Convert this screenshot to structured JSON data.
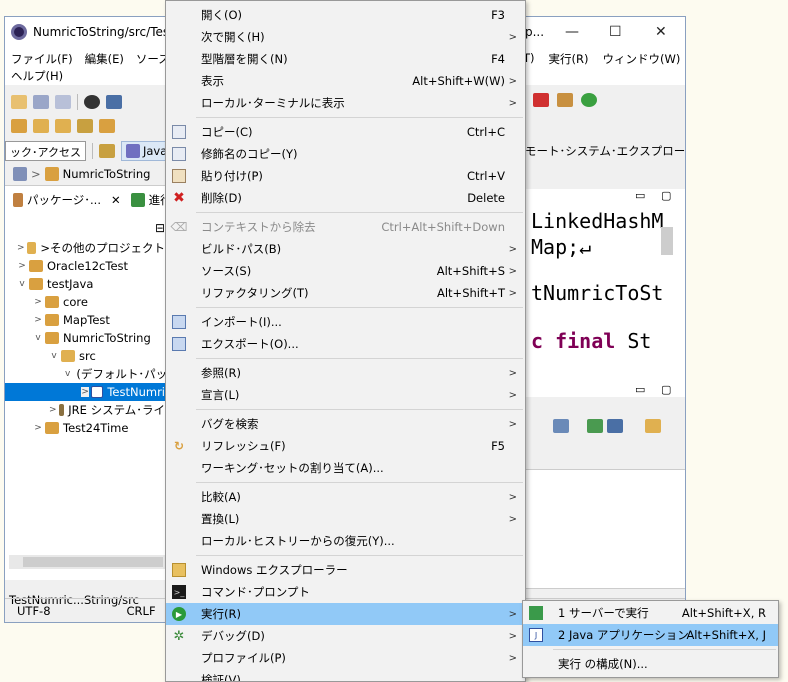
{
  "window": {
    "title": "NumricToString/src/TestN",
    "title_right": "p..."
  },
  "menubar": {
    "items": [
      "ファイル(F)",
      "編集(E)",
      "ソース(S)",
      "ヘルプ(H)"
    ],
    "right_items": [
      "T)",
      "実行(R)",
      "ウィンドウ(W)"
    ]
  },
  "toolbar3": {
    "quick_access": "ック･アクセス",
    "perspective": "Java",
    "remote": "モート･システム･エクスプローラー"
  },
  "breadcrumb": "NumricToString",
  "left_pane": {
    "tab_label": "パッケージ･...",
    "tab2_label": "進行"
  },
  "tree": [
    {
      "label": ">その他のプロジェクト",
      "indent": 0,
      "twisty": ">"
    },
    {
      "label": "Oracle12cTest",
      "indent": 0,
      "twisty": ">"
    },
    {
      "label": "testJava",
      "indent": 0,
      "twisty": "v"
    },
    {
      "label": "core",
      "indent": 1,
      "twisty": ">"
    },
    {
      "label": "MapTest",
      "indent": 1,
      "twisty": ">"
    },
    {
      "label": "NumricToString",
      "indent": 1,
      "twisty": "v"
    },
    {
      "label": "src",
      "indent": 2,
      "twisty": "v"
    },
    {
      "label": "(デフォルト･パッ",
      "indent": 3,
      "twisty": "v"
    },
    {
      "label": "TestNumri",
      "indent": 4,
      "twisty": ">"
    },
    {
      "label": "JRE システム･ライ",
      "indent": 2,
      "twisty": ">"
    },
    {
      "label": "Test24Time",
      "indent": 0,
      "twisty": ">"
    }
  ],
  "editor": {
    "line1": "LinkedHashM",
    "line2": "Map;↵",
    "line3": "tNumricToSt",
    "line4_kw": "c final",
    "line4_rest": " St"
  },
  "pathbar": "TestNumric...String/src",
  "statusbar": {
    "encoding": "UTF-8",
    "line_ending": "CRLF"
  },
  "context_menu": {
    "items": [
      {
        "label": "開く(O)",
        "shortcut": "F3"
      },
      {
        "label": "次で開く(H)",
        "submenu": true
      },
      {
        "label": "型階層を開く(N)",
        "shortcut": "F4"
      },
      {
        "label": "表示",
        "shortcut": "Alt+Shift+W(W)",
        "submenu": true
      },
      {
        "label": "ローカル･ターミナルに表示",
        "submenu": true
      },
      {
        "label": "コピー(C)",
        "shortcut": "Ctrl+C",
        "icon": "copy-icon"
      },
      {
        "label": "修飾名のコピー(Y)",
        "icon": "copy-qualified-icon"
      },
      {
        "label": "貼り付け(P)",
        "shortcut": "Ctrl+V",
        "icon": "paste-icon"
      },
      {
        "label": "削除(D)",
        "shortcut": "Delete",
        "icon": "delete-icon"
      },
      {
        "label": "コンテキストから除去",
        "shortcut": "Ctrl+Alt+Shift+Down",
        "disabled": true
      },
      {
        "label": "ビルド･パス(B)",
        "submenu": true
      },
      {
        "label": "ソース(S)",
        "shortcut": "Alt+Shift+S",
        "submenu": true
      },
      {
        "label": "リファクタリング(T)",
        "shortcut": "Alt+Shift+T",
        "submenu": true
      },
      {
        "label": "インポート(I)...",
        "icon": "import-icon"
      },
      {
        "label": "エクスポート(O)...",
        "icon": "export-icon"
      },
      {
        "label": "参照(R)",
        "submenu": true
      },
      {
        "label": "宣言(L)",
        "submenu": true
      },
      {
        "label": "バグを検索",
        "submenu": true
      },
      {
        "label": "リフレッシュ(F)",
        "shortcut": "F5",
        "icon": "refresh-icon"
      },
      {
        "label": "ワーキング･セットの割り当て(A)..."
      },
      {
        "label": "比較(A)",
        "submenu": true
      },
      {
        "label": "置換(L)",
        "submenu": true
      },
      {
        "label": "ローカル･ヒストリーからの復元(Y)..."
      },
      {
        "label": "Windows エクスプローラー",
        "icon": "explorer-icon"
      },
      {
        "label": "コマンド･プロンプト",
        "icon": "cmd-icon"
      },
      {
        "label": "実行(R)",
        "submenu": true,
        "icon": "run-icon",
        "highlighted": true
      },
      {
        "label": "デバッグ(D)",
        "submenu": true,
        "icon": "debug-icon"
      },
      {
        "label": "プロファイル(P)",
        "submenu": true
      },
      {
        "label": "検証(V)"
      }
    ]
  },
  "submenu": {
    "items": [
      {
        "label": "1 サーバーで実行",
        "shortcut": "Alt+Shift+X, R"
      },
      {
        "label": "2 Java アプリケーション",
        "shortcut": "Alt+Shift+X, J",
        "highlighted": true
      },
      {
        "label": "実行 の構成(N)..."
      }
    ]
  }
}
